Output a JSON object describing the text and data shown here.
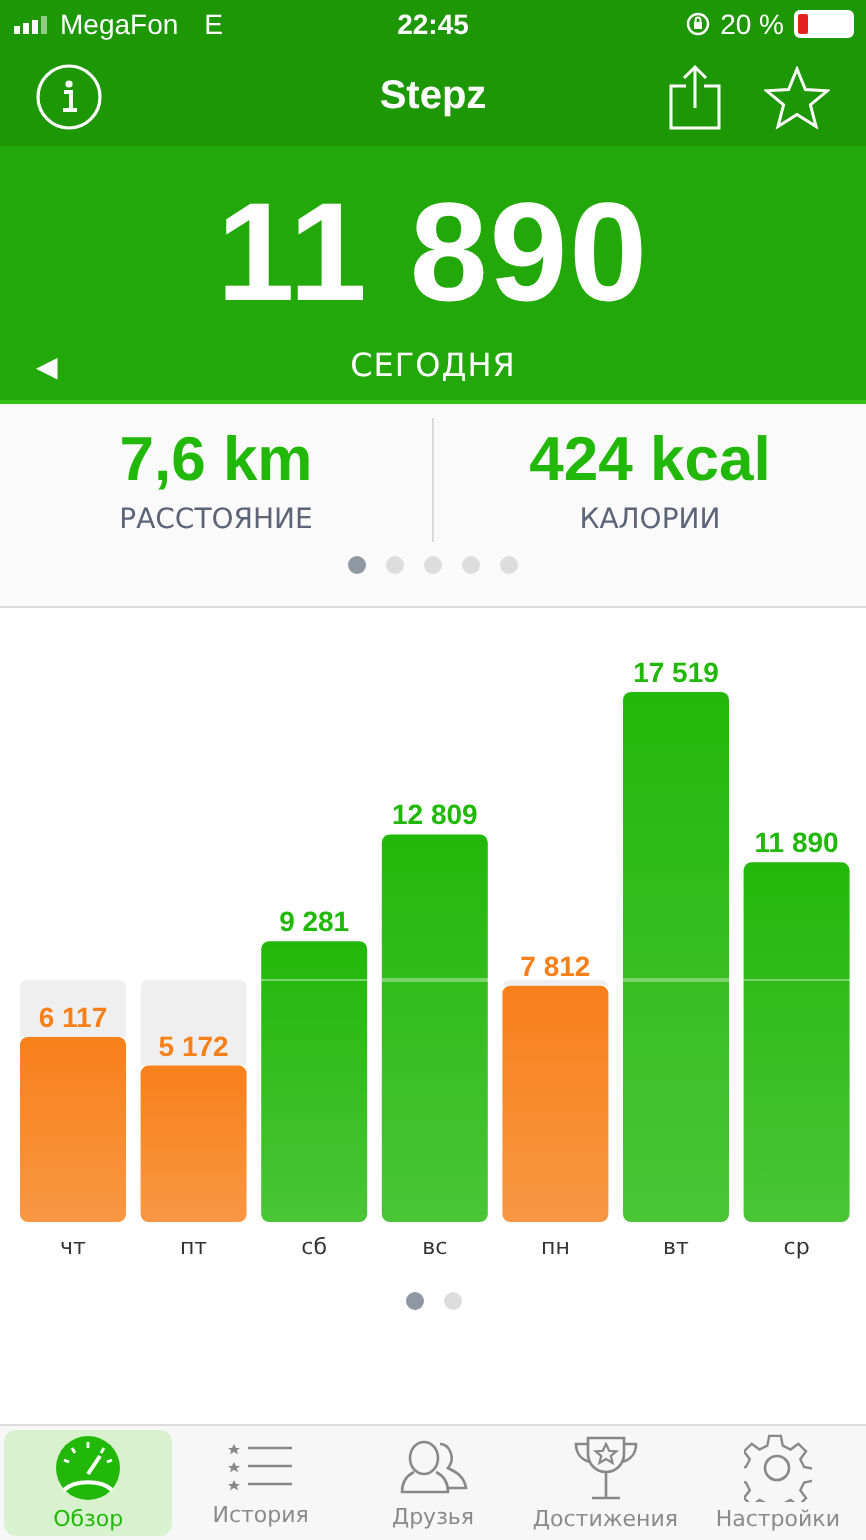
{
  "status_bar": {
    "carrier": "MegaFon",
    "network": "E",
    "time": "22:45",
    "battery": "20 %"
  },
  "nav": {
    "title": "Stepz"
  },
  "hero": {
    "steps": "11 890",
    "label": "СЕГОДНЯ",
    "prev_arrow": "◀"
  },
  "stats": [
    {
      "value": "7,6 km",
      "label": "РАССТОЯНИЕ"
    },
    {
      "value": "424 kcal",
      "label": "КАЛОРИИ"
    }
  ],
  "stats_pages": [
    {
      "selected": true
    },
    {
      "selected": false
    },
    {
      "selected": false
    },
    {
      "selected": false
    },
    {
      "selected": false
    }
  ],
  "chart_data": {
    "type": "bar",
    "categories": [
      "чт",
      "пт",
      "сб",
      "вс",
      "пн",
      "вт",
      "ср"
    ],
    "data_labels": true,
    "ylim": [
      0,
      17519
    ],
    "series": [
      {
        "color": "#f7801a",
        "values": [
          6117,
          5172,
          null,
          null,
          7812,
          null,
          null
        ]
      },
      {
        "color": "#22b80a",
        "values": [
          null,
          null,
          9281,
          12809,
          null,
          17519,
          11890
        ]
      }
    ],
    "value_labels": [
      "6 117",
      "5 172",
      "9 281",
      "12 809",
      "7 812",
      "17 519",
      "11 890"
    ]
  },
  "chart_pages": [
    {
      "selected": true
    },
    {
      "selected": false
    }
  ],
  "tabs": [
    {
      "label": "Обзор",
      "kind": "gauge",
      "selected": true
    },
    {
      "label": "История",
      "kind": "list",
      "selected": false
    },
    {
      "label": "Друзья",
      "kind": "people",
      "selected": false
    },
    {
      "label": "Достижения",
      "kind": "trophy",
      "selected": false
    },
    {
      "label": "Настройки",
      "kind": "gear",
      "selected": false
    }
  ]
}
